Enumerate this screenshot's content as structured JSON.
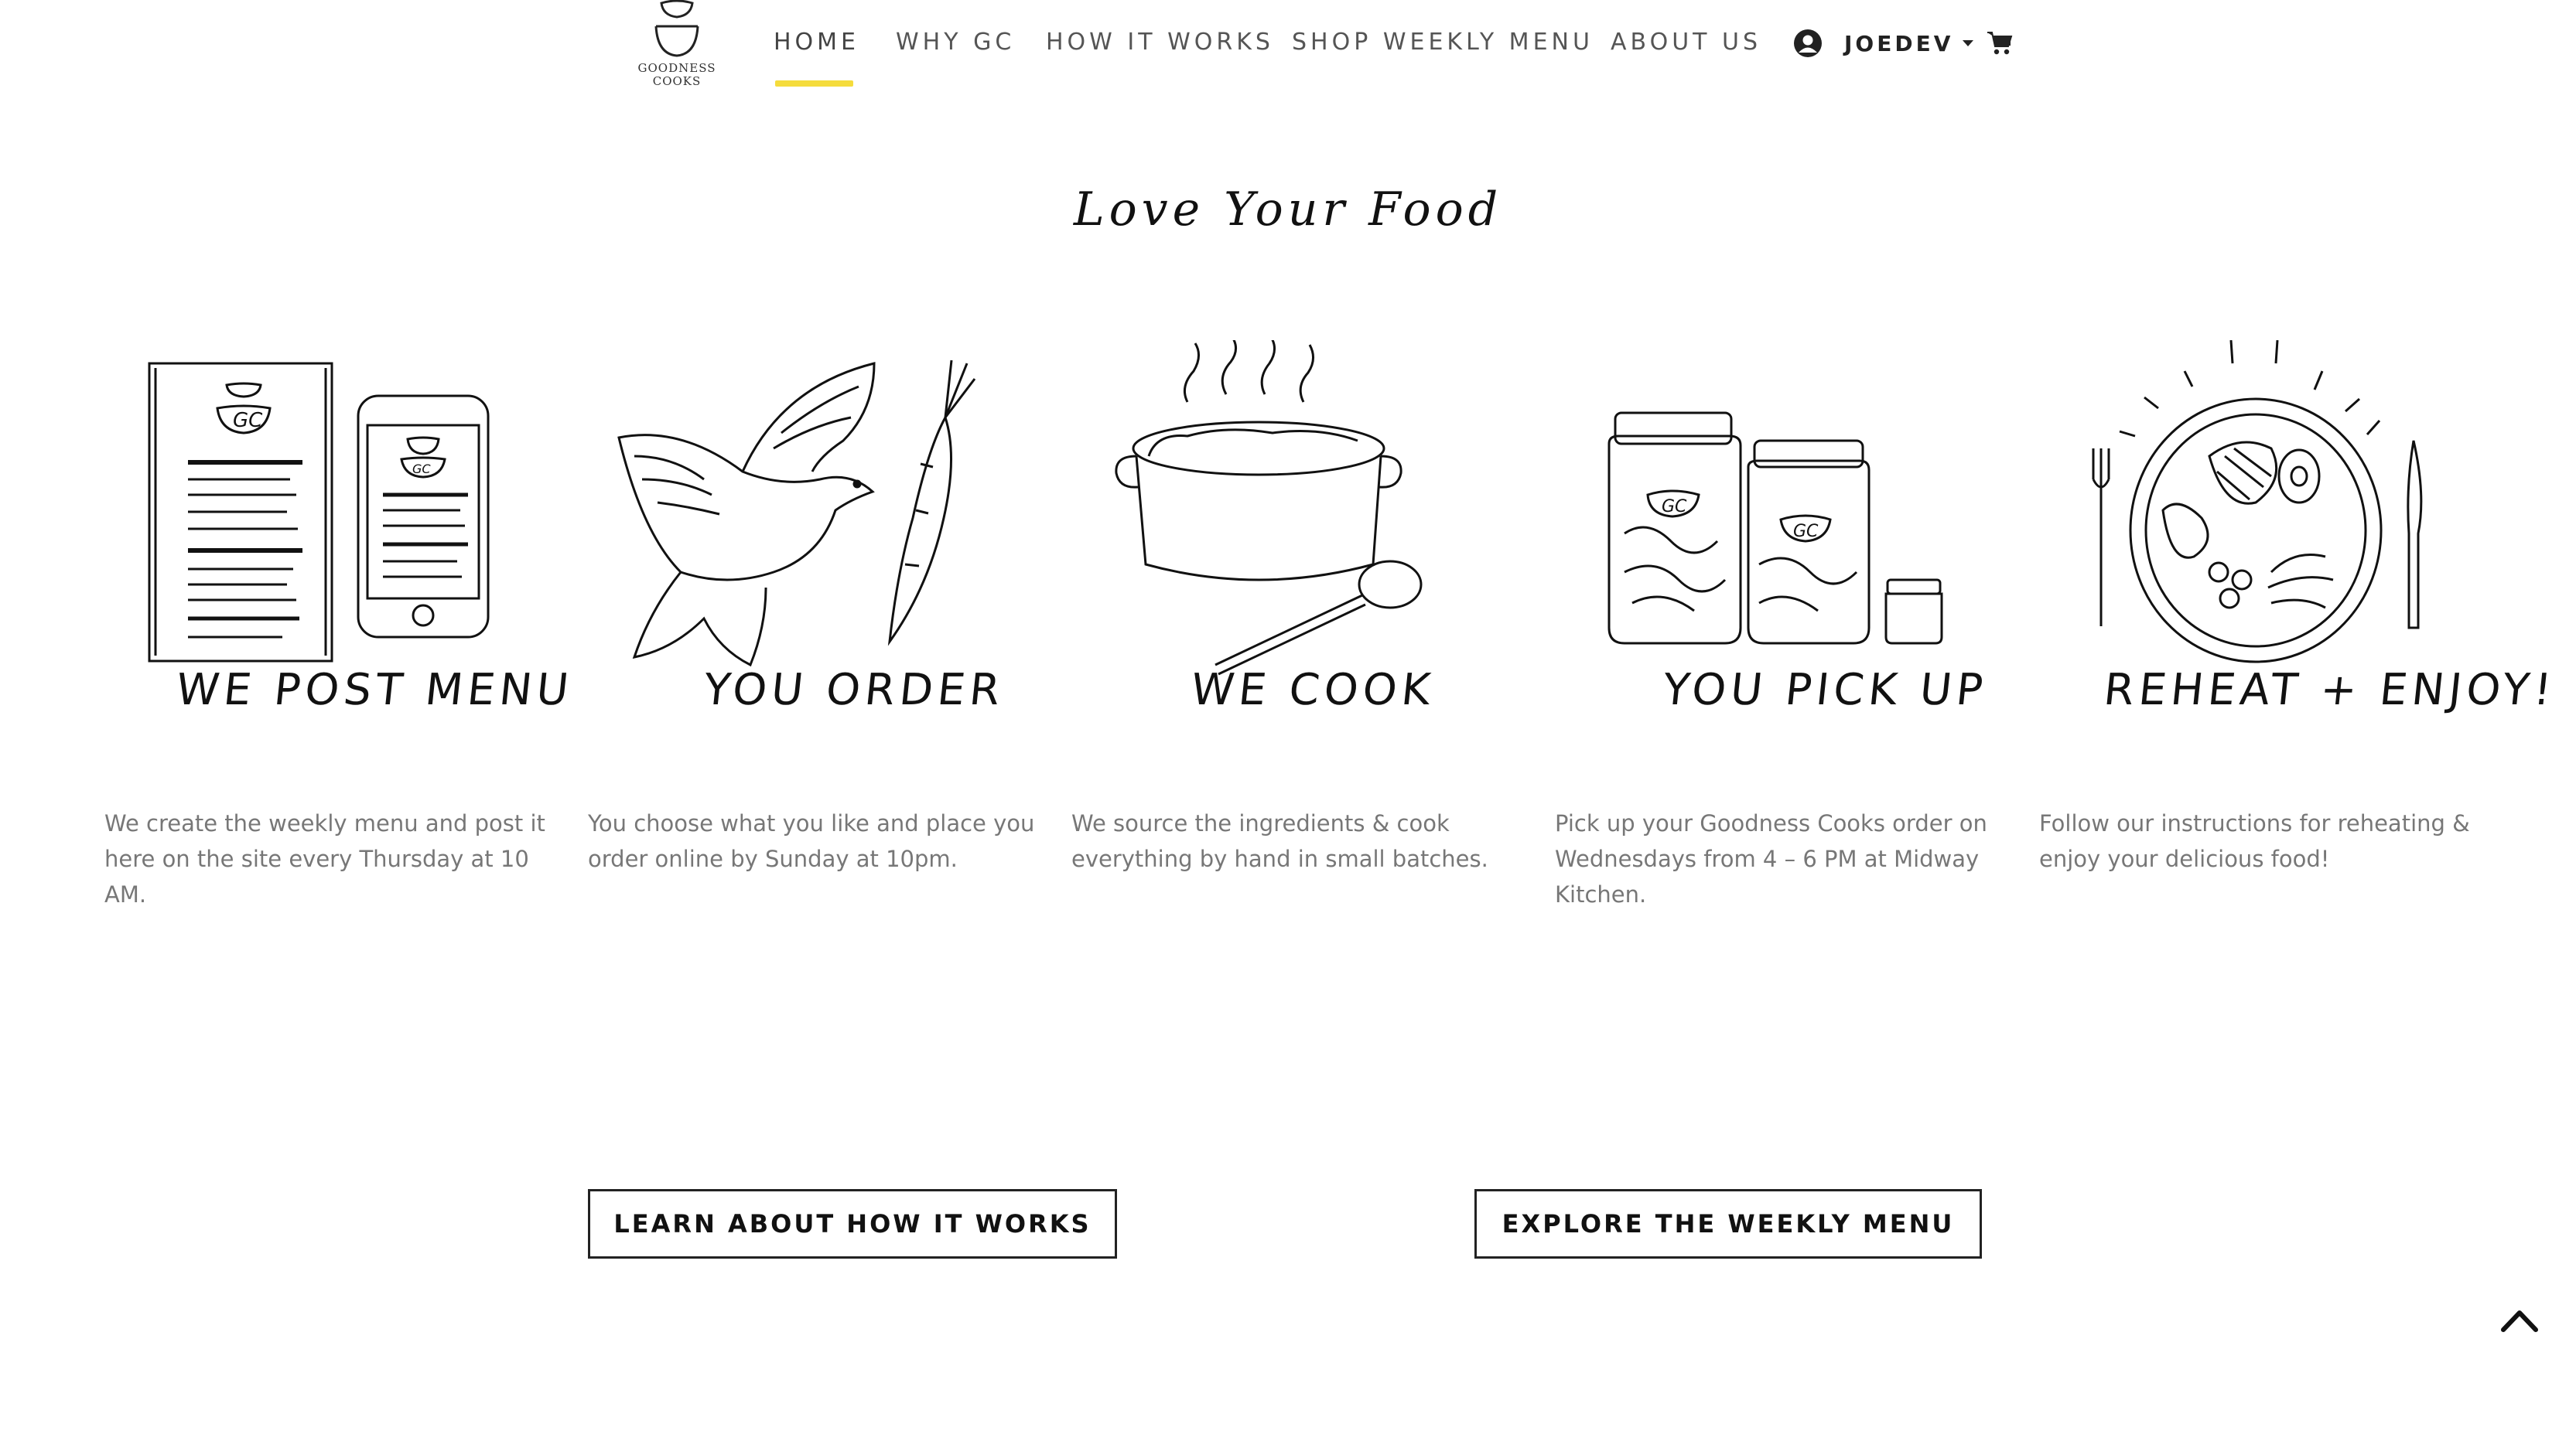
{
  "brand": {
    "line1": "GOODNESS",
    "line2": "COOKS"
  },
  "nav": {
    "home": "HOME",
    "why": "WHY GC",
    "how": "HOW IT WORKS",
    "shop": "SHOP WEEKLY MENU",
    "about": "ABOUT US"
  },
  "user": {
    "name": "JOEDEV"
  },
  "icons": {
    "account": "user-circle-icon",
    "caret": "caret-down-icon",
    "cart": "shopping-cart-icon",
    "back_to_top": "chevron-up-icon"
  },
  "colors": {
    "accent": "#f5dc3c",
    "text": "#111111",
    "muted": "#777777"
  },
  "heading": "Love Your Food",
  "steps": [
    {
      "label": "WE POST MENU",
      "description": "We create the weekly menu and post it here on the site every Thursday at 10 AM."
    },
    {
      "label": "YOU ORDER",
      "description": "You choose what you like and place you order online by Sunday at 10pm."
    },
    {
      "label": "WE COOK",
      "description": "We source the ingredients & cook everything by hand in small batches."
    },
    {
      "label": "YOU PICK UP",
      "description": "Pick up your Goodness Cooks order on Wednesdays from 4 – 6 PM at Midway Kitchen."
    },
    {
      "label": "REHEAT + ENJOY!",
      "description": "Follow our instructions for reheating & enjoy your delicious food!"
    }
  ],
  "buttons": {
    "learn": "LEARN ABOUT HOW IT WORKS",
    "explore": "EXPLORE THE WEEKLY MENU"
  }
}
